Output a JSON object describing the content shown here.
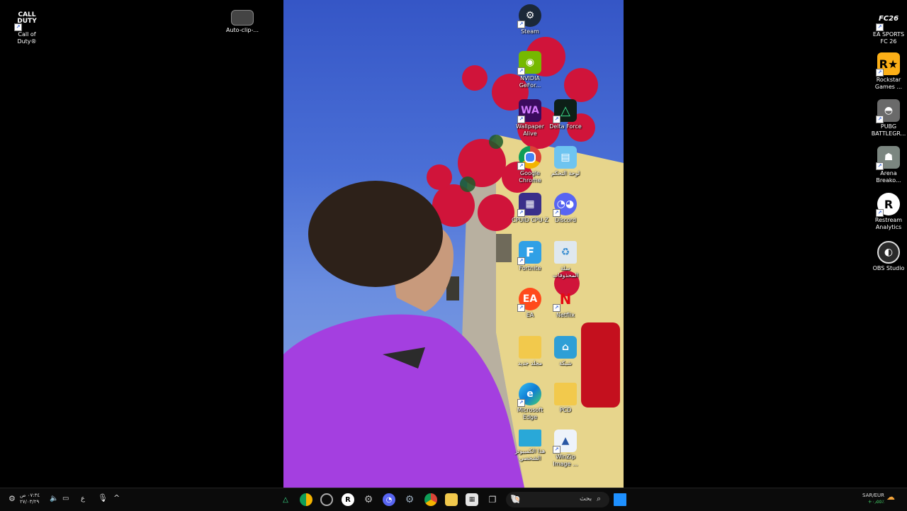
{
  "desktop_left": [
    {
      "label": "Call of\nDuty®",
      "icon": "call-of-duty-icon"
    },
    {
      "label": "Auto-clip-...",
      "icon": "video-file-icon"
    }
  ],
  "desktop_center_col1": [
    {
      "label": "Steam",
      "icon": "steam-icon"
    },
    {
      "label": "NVIDIA\nGeFor...",
      "icon": "nvidia-icon"
    },
    {
      "label": "Wallpaper\nAlive",
      "icon": "wallpaper-alive-icon"
    },
    {
      "label": "Google\nChrome",
      "icon": "chrome-icon"
    },
    {
      "label": "CPUID CPU-Z",
      "icon": "cpuz-icon"
    },
    {
      "label": "Fortnite",
      "icon": "fortnite-icon"
    },
    {
      "label": "EA",
      "icon": "ea-icon"
    },
    {
      "label": "مجلد جديد",
      "icon": "folder-icon"
    },
    {
      "label": "Microsoft\nEdge",
      "icon": "edge-icon"
    },
    {
      "label": "هذا الكمبيوتر\nالشخصي",
      "icon": "this-pc-icon"
    }
  ],
  "desktop_center_col2": [
    {
      "label": "Delta Force",
      "icon": "delta-force-icon"
    },
    {
      "label": "لوحة التحكم",
      "icon": "control-panel-icon"
    },
    {
      "label": "Discord",
      "icon": "discord-icon"
    },
    {
      "label": "سلة\nالمحذوفات",
      "icon": "recycle-bin-icon"
    },
    {
      "label": "Netflix",
      "icon": "netflix-icon"
    },
    {
      "label": "شبكة",
      "icon": "network-icon"
    },
    {
      "label": "PCD",
      "icon": "folder-icon"
    },
    {
      "label": "WinZip\nImage ...",
      "icon": "winzip-icon"
    }
  ],
  "desktop_right": [
    {
      "label": "EA SPORTS\nFC 26",
      "icon": "ea-sports-fc-icon"
    },
    {
      "label": "Rockstar\nGames ...",
      "icon": "rockstar-icon"
    },
    {
      "label": "PUBG\nBATTLEGR...",
      "icon": "pubg-icon"
    },
    {
      "label": "Arena\nBreako...",
      "icon": "arena-breakout-icon"
    },
    {
      "label": "Restream\nAnalytics",
      "icon": "restream-icon"
    },
    {
      "label": "OBS Studio",
      "icon": "obs-icon"
    }
  ],
  "taskbar": {
    "search_placeholder": "بحث",
    "clock_time": "٠٧:٣٤ ص",
    "clock_date": "٢٧/٠٣/٢٩",
    "input_lang": "ع",
    "ticker_name": "SAR/EUR",
    "ticker_change": "+٠٫٥٥٪",
    "apps": [
      "delta-force",
      "chrome-canary",
      "clock-app",
      "restream",
      "settings",
      "discord",
      "steam",
      "chrome",
      "file-explorer",
      "store",
      "task-view",
      "widgets-search"
    ]
  },
  "colors": {
    "taskbar_bg": "#0b0b0b",
    "start_blue": "#1e90ff"
  }
}
